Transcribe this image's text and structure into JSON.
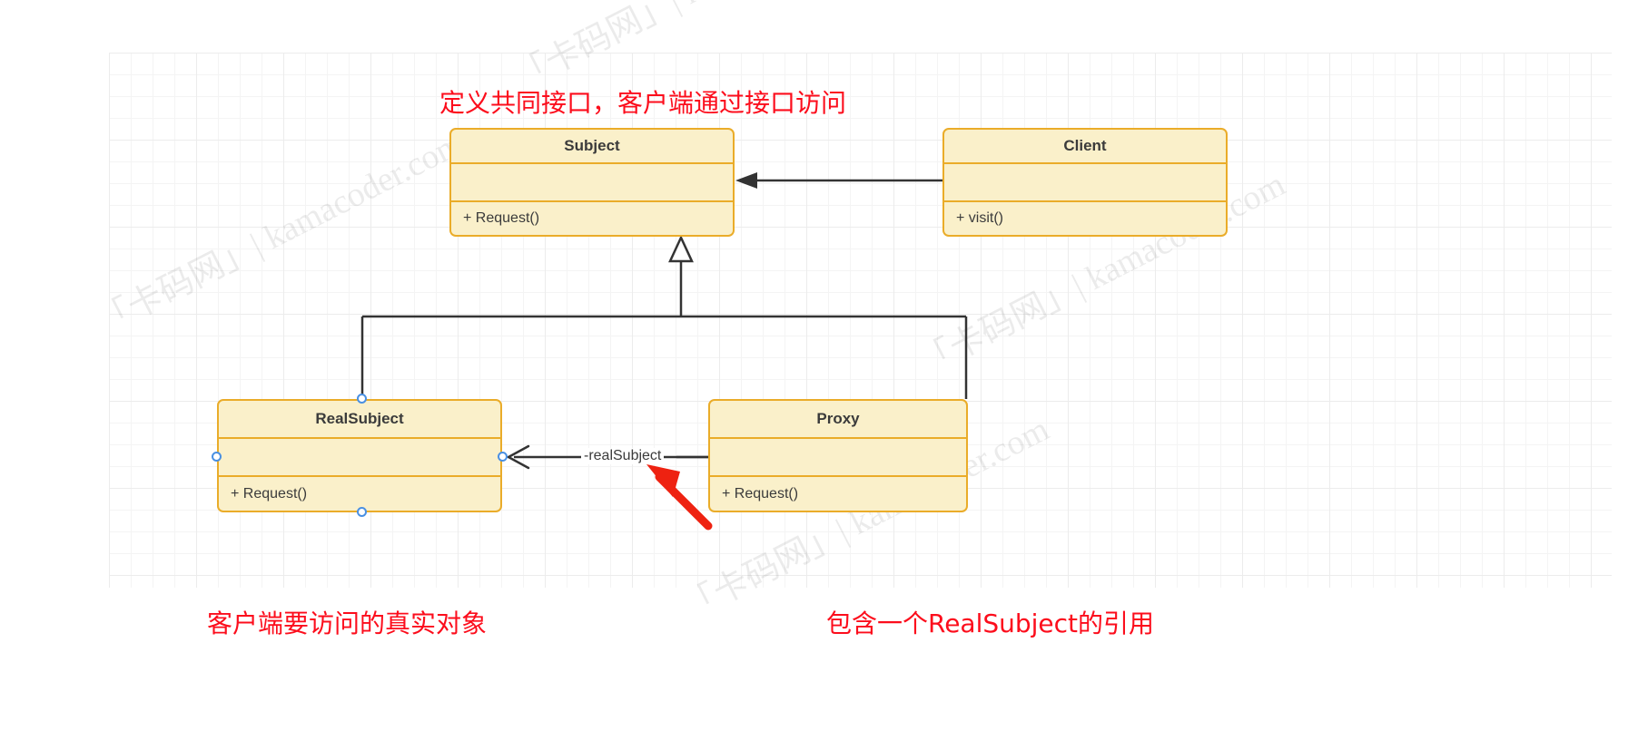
{
  "diagram": {
    "title": "Proxy Pattern UML Class Diagram",
    "type": "uml-class-diagram",
    "background": "#ffffff",
    "grid_color": "#ececec",
    "box_fill": "#faf0ca",
    "box_border": "#eaac29",
    "annotation_color": "#fc0d1c",
    "connector_color": "#333333",
    "handle_color": "#4a90e2"
  },
  "classes": [
    {
      "id": "subject",
      "name": "Subject",
      "attributes": [],
      "operations": [
        "+ Request()"
      ]
    },
    {
      "id": "client",
      "name": "Client",
      "attributes": [],
      "operations": [
        "+ visit()"
      ]
    },
    {
      "id": "realsubject",
      "name": "RealSubject",
      "attributes": [],
      "operations": [
        "+ Request()"
      ]
    },
    {
      "id": "proxy",
      "name": "Proxy",
      "attributes": [],
      "operations": [
        "+ Request()"
      ]
    }
  ],
  "relations": [
    {
      "id": "client-to-subject",
      "from": "Client",
      "to": "Subject",
      "kind": "association",
      "arrowhead": "filled",
      "label": ""
    },
    {
      "id": "realsubject-to-subject",
      "from": "RealSubject",
      "to": "Subject",
      "kind": "generalization",
      "arrowhead": "hollow-triangle",
      "label": ""
    },
    {
      "id": "proxy-to-subject",
      "from": "Proxy",
      "to": "Subject",
      "kind": "generalization",
      "arrowhead": "hollow-triangle",
      "label": ""
    },
    {
      "id": "proxy-to-realsubject",
      "from": "Proxy",
      "to": "RealSubject",
      "kind": "association",
      "arrowhead": "open",
      "label": "-realSubject"
    }
  ],
  "annotations": [
    {
      "id": "note-subject",
      "text": "定义共同接口，客户端通过接口访问"
    },
    {
      "id": "note-realsubject",
      "text": "客户端要访问的真实对象"
    },
    {
      "id": "note-proxy",
      "text": "包含一个RealSubject的引用"
    }
  ],
  "watermark": {
    "text": "「卡码网」| kamacoder.com"
  }
}
